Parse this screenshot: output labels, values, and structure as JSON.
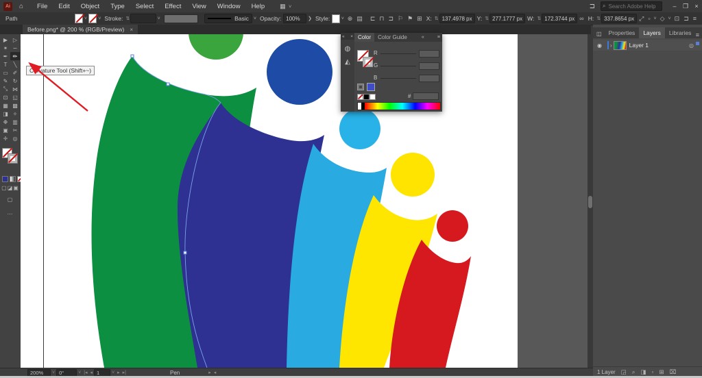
{
  "menubar": {
    "items": [
      "File",
      "Edit",
      "Object",
      "Type",
      "Select",
      "Effect",
      "View",
      "Window",
      "Help"
    ],
    "search_placeholder": "Search Adobe Help",
    "logo_text": "Ai"
  },
  "icons": {
    "home": "⌂",
    "workspace": "▦",
    "chevron": "˅",
    "search": "⌕",
    "minimize": "–",
    "restore": "❐",
    "close": "×",
    "stepper": "⇅",
    "globe": "⊕",
    "docsetup": "▤",
    "align_left": "⊏",
    "align_center": "⊓",
    "align_right": "⊐",
    "flag_outline": "⚐",
    "flag_filled": "⚑",
    "ref_point": "⊞",
    "link": "∞",
    "transform": "⤢",
    "corner_widget": "▫",
    "shear_widget": "◇",
    "fullscreen": "⊡",
    "dock_panel": "⊐",
    "hamburger": "≡",
    "panel_strip_1": "◍",
    "panel_strip_2": "◭",
    "eye": "◉",
    "expand": "›",
    "target": "◎",
    "collapse_left": "«",
    "collapse_right": "«",
    "panel_collapse": "◫",
    "collect": "◲",
    "locate": "⌕",
    "mask": "◨",
    "sublayer": "▫",
    "new_layer": "⊞",
    "trash": "⌧",
    "nav_first": "|◂",
    "nav_prev": "◂",
    "nav_next": "▸",
    "nav_last": "▸|",
    "split_r": "▸",
    "split_l": "◂",
    "draw_normal": "▢",
    "draw_behind": "◪",
    "draw_inside": "▣",
    "screen_mode": "▢",
    "more_dots": "⋯"
  },
  "control_bar": {
    "selection_label": "Path",
    "stroke_label": "Stroke:",
    "brush_name": "Basic",
    "opacity_label": "Opacity:",
    "opacity_value": "100%",
    "opacity_more": "❯",
    "style_label": "Style:",
    "x_label": "X:",
    "x_value": "137.4978 px",
    "y_label": "Y:",
    "y_value": "277.1777 px",
    "w_label": "W:",
    "w_value": "172.3744 px",
    "h_label": "H:",
    "h_value": "337.8654 px"
  },
  "document_tab": {
    "title": "Before.png* @ 200 % (RGB/Preview)",
    "close": "×"
  },
  "toolbar": {
    "tools": [
      {
        "name": "selection-tool",
        "glyph": "▶"
      },
      {
        "name": "direct-selection-tool",
        "glyph": "▷"
      },
      {
        "name": "magic-wand-tool",
        "glyph": "✶"
      },
      {
        "name": "lasso-tool",
        "glyph": "∽"
      },
      {
        "name": "pen-tool",
        "glyph": "✒"
      },
      {
        "name": "curvature-tool",
        "glyph": "✏",
        "selected": true
      },
      {
        "name": "type-tool",
        "glyph": "T"
      },
      {
        "name": "line-segment-tool",
        "glyph": "╲"
      },
      {
        "name": "rectangle-tool",
        "glyph": "▭"
      },
      {
        "name": "paintbrush-tool",
        "glyph": "✐"
      },
      {
        "name": "shaper-tool",
        "glyph": "✎"
      },
      {
        "name": "rotate-tool",
        "glyph": "↻"
      },
      {
        "name": "scale-tool",
        "glyph": "⤡"
      },
      {
        "name": "width-tool",
        "glyph": "⋈"
      },
      {
        "name": "free-transform-tool",
        "glyph": "⊡"
      },
      {
        "name": "shape-builder-tool",
        "glyph": "◱"
      },
      {
        "name": "perspective-grid-tool",
        "glyph": "▦"
      },
      {
        "name": "mesh-tool",
        "glyph": "▩"
      },
      {
        "name": "gradient-tool",
        "glyph": "◨"
      },
      {
        "name": "eyedropper-tool",
        "glyph": "✧"
      },
      {
        "name": "symbol-sprayer-tool",
        "glyph": "❉"
      },
      {
        "name": "column-graph-tool",
        "glyph": "▥"
      },
      {
        "name": "artboard-tool",
        "glyph": "▣"
      },
      {
        "name": "slice-tool",
        "glyph": "✂"
      },
      {
        "name": "hand-tool",
        "glyph": "✛"
      },
      {
        "name": "zoom-tool",
        "glyph": "◎"
      }
    ]
  },
  "tooltip": {
    "text": "Curvature Tool (Shift+~)"
  },
  "annotation": {
    "color": "#e01b24"
  },
  "logo": {
    "colors": {
      "green_head": "#3aa53c",
      "green": "#0d8f42",
      "blue_head": "#1d4ba5",
      "indigo": "#2e3192",
      "cyan_head": "#29b2e8",
      "cyan": "#29abe2",
      "yellow_head": "#ffe400",
      "yellow": "#ffe600",
      "red_head": "#d6191e",
      "red": "#d6191e",
      "trace_path": "#7ba2e8"
    }
  },
  "color_panel": {
    "tabs": {
      "color": "Color",
      "color_guide": "Color Guide"
    },
    "r_label": "R",
    "g_label": "G",
    "b_label": "B",
    "hex_label": "#",
    "strip_close": "×"
  },
  "layers_panel": {
    "tab_properties": "Properties",
    "tab_layers": "Layers",
    "tab_libraries": "Libraries",
    "layer_name": "Layer 1",
    "footer_count": "1 Layer"
  },
  "status_bar": {
    "zoom": "200%",
    "rotation": "0°",
    "artboard": "1",
    "tool": "Pen"
  }
}
